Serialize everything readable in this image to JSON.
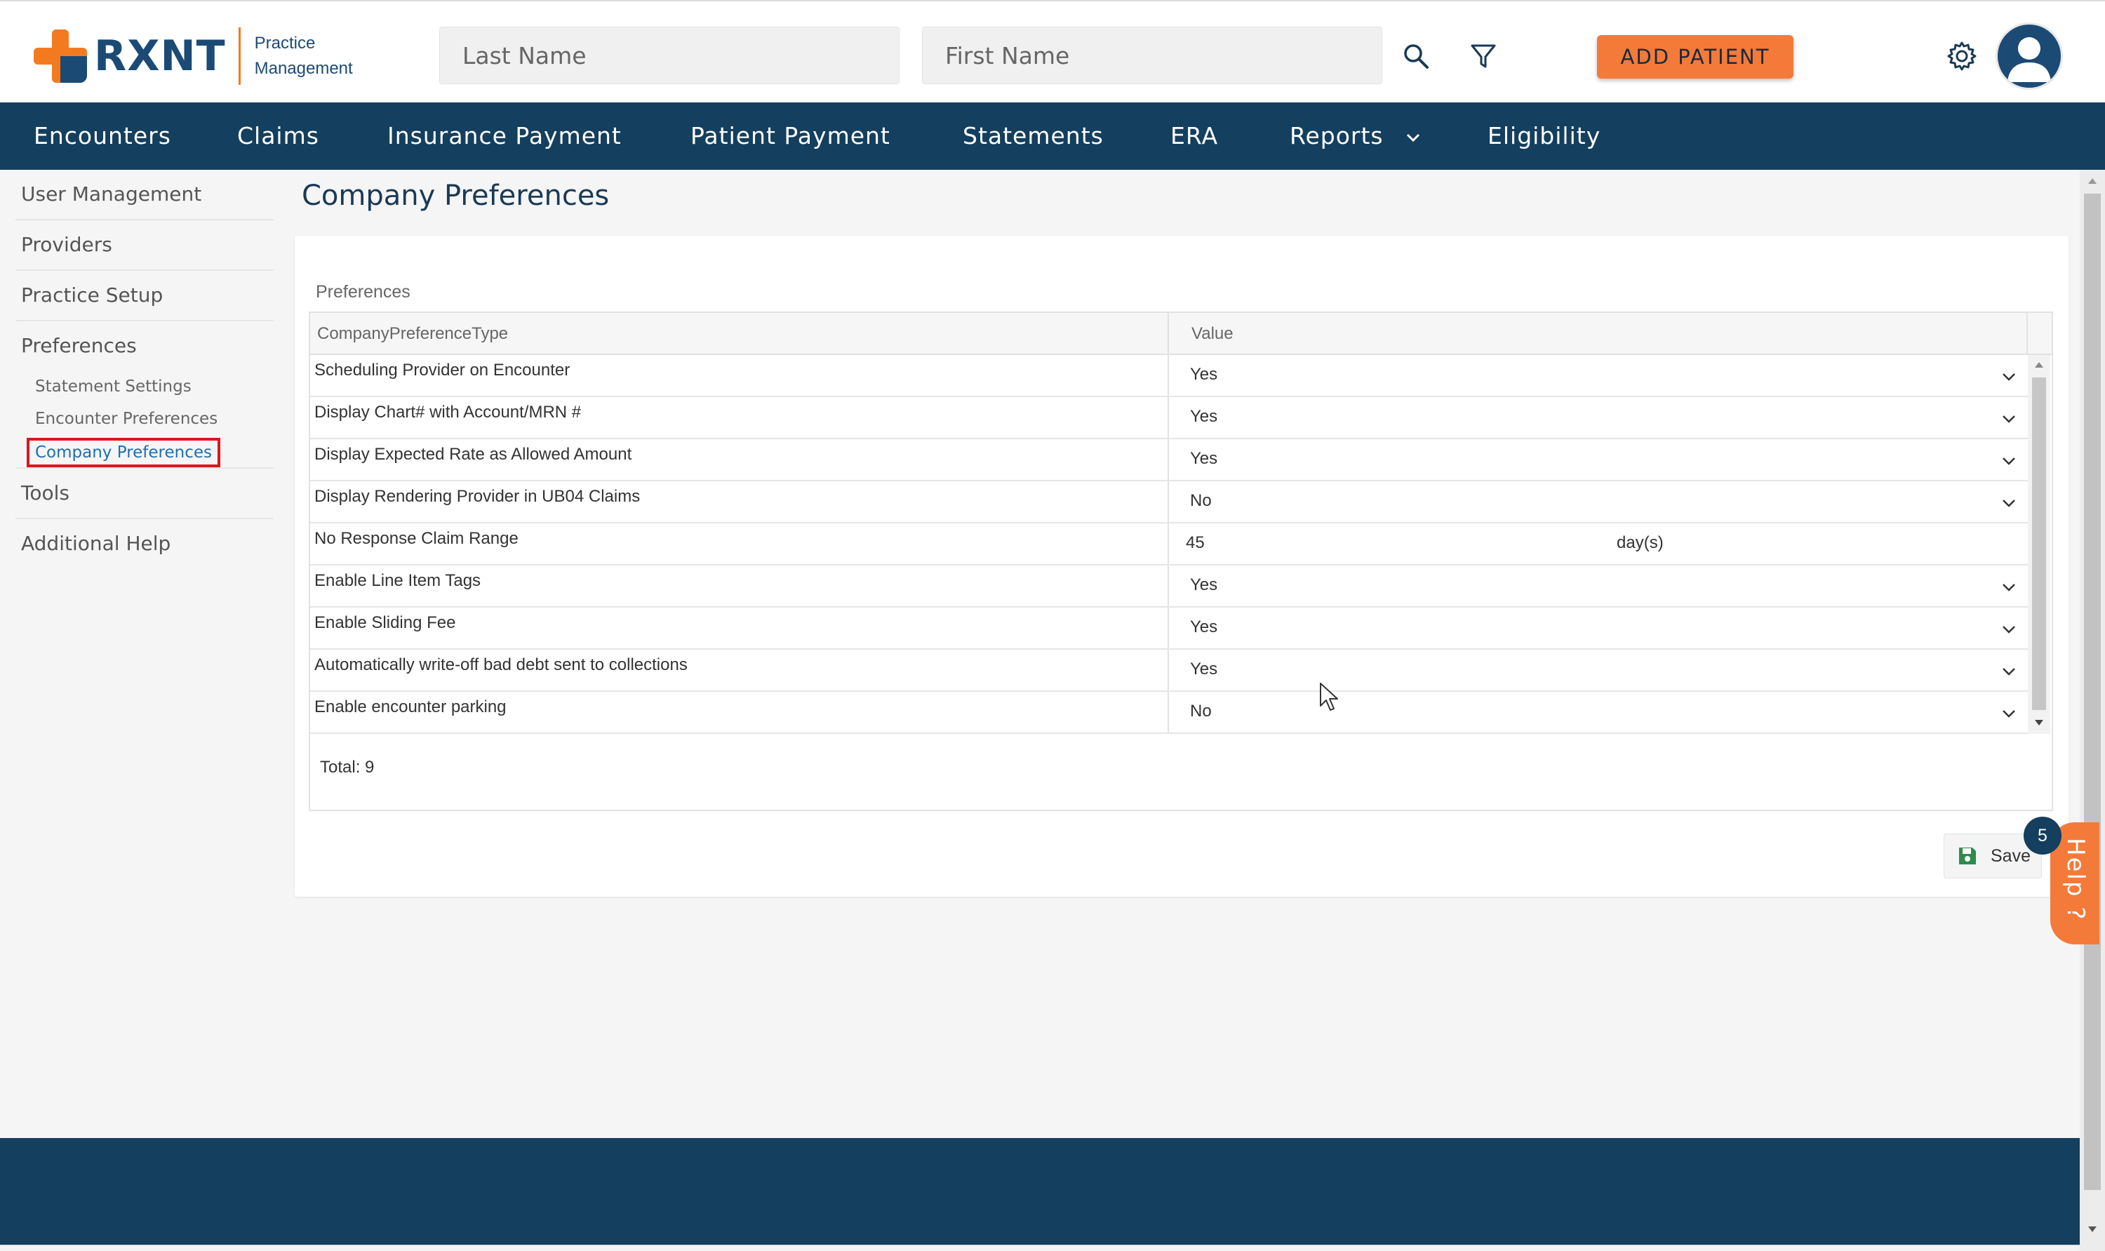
{
  "app": {
    "logo_text": "RXNT",
    "logo_sub_line1": "Practice",
    "logo_sub_line2": "Management"
  },
  "header": {
    "last_name_placeholder": "Last Name",
    "first_name_placeholder": "First Name",
    "add_patient_label": "ADD PATIENT"
  },
  "nav": {
    "encounters": "Encounters",
    "claims": "Claims",
    "insurance_payment": "Insurance Payment",
    "patient_payment": "Patient Payment",
    "statements": "Statements",
    "era": "ERA",
    "reports": "Reports",
    "eligibility": "Eligibility"
  },
  "sidebar": {
    "user_management": "User Management",
    "providers": "Providers",
    "practice_setup": "Practice Setup",
    "preferences": "Preferences",
    "statement_settings": "Statement Settings",
    "encounter_preferences": "Encounter Preferences",
    "company_preferences": "Company Preferences",
    "tools": "Tools",
    "additional_help": "Additional Help"
  },
  "main": {
    "page_title": "Company Preferences",
    "section_label": "Preferences",
    "columns": [
      "CompanyPreferenceType",
      "Value"
    ],
    "rows": [
      {
        "type": "Scheduling Provider on Encounter",
        "value": "Yes"
      },
      {
        "type": "Display Chart# with Account/MRN #",
        "value": "Yes"
      },
      {
        "type": "Display Expected Rate as Allowed Amount",
        "value": "Yes"
      },
      {
        "type": "Display Rendering Provider in UB04 Claims",
        "value": "No"
      },
      {
        "type": "No Response Claim Range",
        "value": "45",
        "unit": "day(s)"
      },
      {
        "type": "Enable Line Item Tags",
        "value": "Yes"
      },
      {
        "type": "Enable Sliding Fee",
        "value": "Yes"
      },
      {
        "type": "Automatically write-off bad debt sent to collections",
        "value": "Yes"
      },
      {
        "type": "Enable encounter parking",
        "value": "No"
      }
    ],
    "total_label": "Total: 9",
    "save_label": "Save"
  },
  "help": {
    "badge_count": "5",
    "label": "Help ?"
  },
  "colors": {
    "brand_navy": "#143f5e",
    "brand_orange": "#f47a3a",
    "active_link": "#1f6fb0",
    "highlight_border": "#e0141e"
  }
}
